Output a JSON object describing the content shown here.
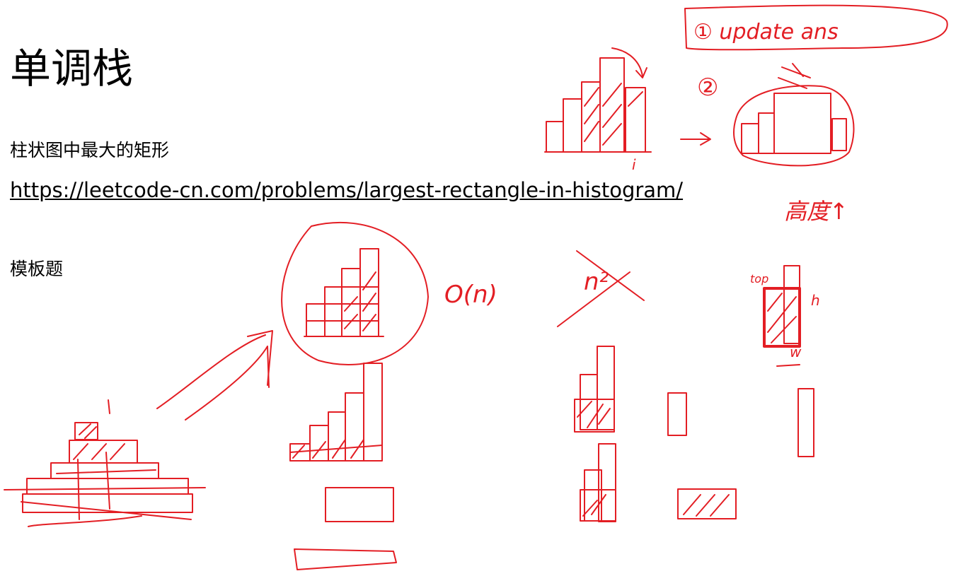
{
  "page": {
    "title": "单调栈",
    "problem_name": "柱状图中最大的矩形",
    "problem_link": "https://leetcode-cn.com/problems/largest-rectangle-in-histogram/",
    "note": "模板题"
  },
  "handwriting": {
    "ink_color": "#e31e24",
    "step_one": "① update ans",
    "step_two": "②",
    "index_mark": "i",
    "height_up": "高度↑",
    "complexity": "O(n)",
    "crossed_out": "n²",
    "label_top": "top",
    "label_h": "h",
    "label_w": "w",
    "one_mark": "1"
  }
}
